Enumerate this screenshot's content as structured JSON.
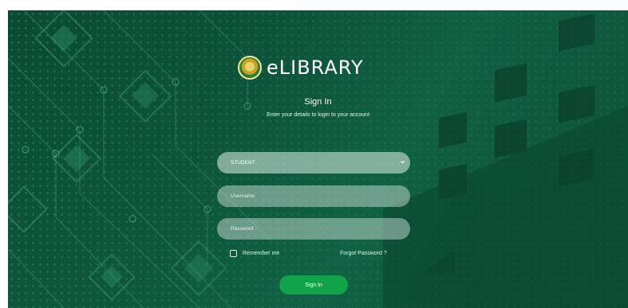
{
  "brand": {
    "logo_text": "eLIBRARY",
    "logo_icon": "university-seal-icon"
  },
  "login": {
    "title": "Sign In",
    "subtitle": "Enter your details to login to your account",
    "role_select": {
      "value": "STUDENT",
      "icon": "chevron-down-icon"
    },
    "username_placeholder": "Username",
    "password_placeholder": "Password",
    "remember_label": "Remember me",
    "forgot_label": "Forgot Password ?",
    "submit_label": "Sign In"
  },
  "colors": {
    "background": "#0f5c40",
    "button": "#12a24a",
    "field": "#dcebe4",
    "text": "#ffffff"
  }
}
